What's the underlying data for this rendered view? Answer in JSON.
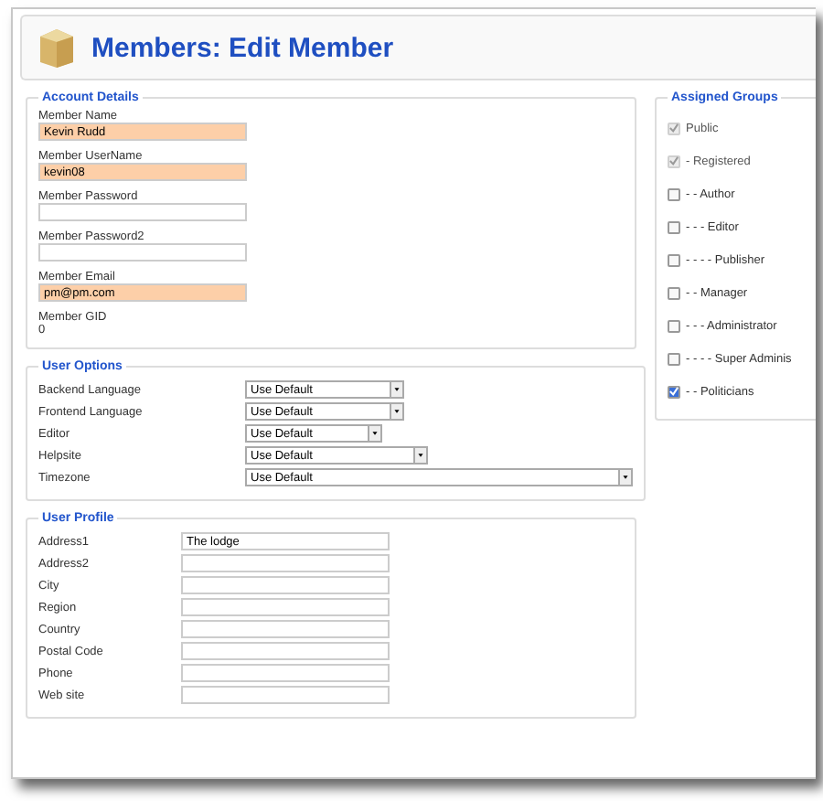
{
  "header": {
    "title": "Members: Edit Member"
  },
  "account_details": {
    "legend": "Account Details",
    "fields": [
      {
        "label": "Member Name",
        "value": "Kevin Rudd",
        "highlighted": true
      },
      {
        "label": "Member UserName",
        "value": "kevin08",
        "highlighted": true
      },
      {
        "label": "Member Password",
        "highlighted": false
      },
      {
        "label": "Member Password2",
        "highlighted": false
      },
      {
        "label": "Member Email",
        "value": "pm@pm.com",
        "highlighted": true
      }
    ],
    "gid": {
      "label": "Member GID",
      "value": "0"
    }
  },
  "user_options": {
    "legend": "User Options",
    "rows": [
      {
        "label": "Backend Language",
        "value": "Use Default"
      },
      {
        "label": "Frontend Language",
        "value": "Use Default"
      },
      {
        "label": "Editor",
        "value": "Use Default"
      },
      {
        "label": "Helpsite",
        "value": "Use Default"
      },
      {
        "label": "Timezone",
        "value": "Use Default"
      }
    ]
  },
  "user_profile": {
    "legend": "User Profile",
    "rows": [
      {
        "label": "Address1",
        "value": "The lodge"
      },
      {
        "label": "Address2"
      },
      {
        "label": "City"
      },
      {
        "label": "Region"
      },
      {
        "label": "Country"
      },
      {
        "label": "Postal Code"
      },
      {
        "label": "Phone"
      },
      {
        "label": "Web site"
      }
    ]
  },
  "assigned_groups": {
    "legend": "Assigned Groups",
    "groups": [
      {
        "label": "Public",
        "checked": true,
        "disabled": true
      },
      {
        "label": "- Registered",
        "checked": true,
        "disabled": true
      },
      {
        "label": "- - Author",
        "checked": false,
        "disabled": false
      },
      {
        "label": "- - - Editor",
        "checked": false,
        "disabled": false
      },
      {
        "label": "- - - - Publisher",
        "checked": false,
        "disabled": false
      },
      {
        "label": "- - Manager",
        "checked": false,
        "disabled": false
      },
      {
        "label": "- - - Administrator",
        "checked": false,
        "disabled": false
      },
      {
        "label": "- - - - Super Adminis",
        "checked": false,
        "disabled": false
      },
      {
        "label": "- - Politicians",
        "checked": true,
        "disabled": false
      }
    ]
  }
}
